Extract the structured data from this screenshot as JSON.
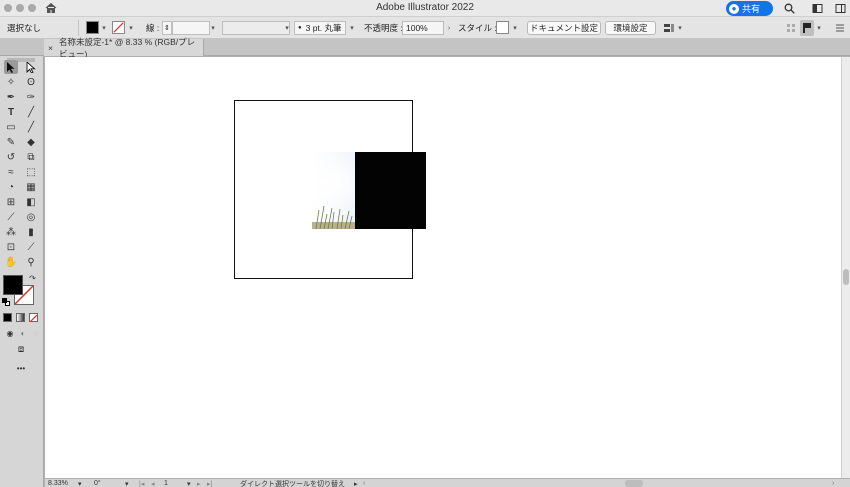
{
  "window": {
    "app_title": "Adobe Illustrator 2022",
    "share_label": "共有"
  },
  "control_bar": {
    "selection_label": "選択なし",
    "stroke_label": "線 :",
    "stroke_profile": "3 pt. 丸筆",
    "opacity_label": "不透明度 :",
    "opacity_value": "100%",
    "style_label": "スタイル :",
    "document_setup": "ドキュメント設定",
    "preferences": "環境設定"
  },
  "document_tab": {
    "close_glyph": "×",
    "title": "名称未設定-1* @ 8.33 % (RGB/プレビュー)"
  },
  "status_bar": {
    "zoom": "8.33%",
    "rotation": "0°",
    "artboard_number": "1",
    "tool_hint": "ダイレクト選択ツールを切り替え"
  },
  "toolbox": {
    "more_glyph": "•••",
    "tools": [
      "selection-tool",
      "direct-selection-tool",
      "magic-wand-tool",
      "lasso-tool",
      "pen-tool",
      "curvature-tool",
      "type-tool",
      "line-segment-tool",
      "rectangle-tool",
      "paintbrush-tool",
      "pencil-tool",
      "eraser-tool",
      "rotate-tool",
      "scale-tool",
      "width-tool",
      "free-transform-tool",
      "shape-builder-tool",
      "perspective-grid-tool",
      "mesh-tool",
      "gradient-tool",
      "eyedropper-tool",
      "blend-tool",
      "symbol-sprayer-tool",
      "column-graph-tool",
      "artboard-tool",
      "slice-tool",
      "hand-tool",
      "zoom-tool"
    ]
  },
  "colors": {
    "accent": "#1473e6",
    "fill": "#000000",
    "stroke": "none",
    "canvas": "#ffffff",
    "pasteboard": "#b0b0b0"
  }
}
